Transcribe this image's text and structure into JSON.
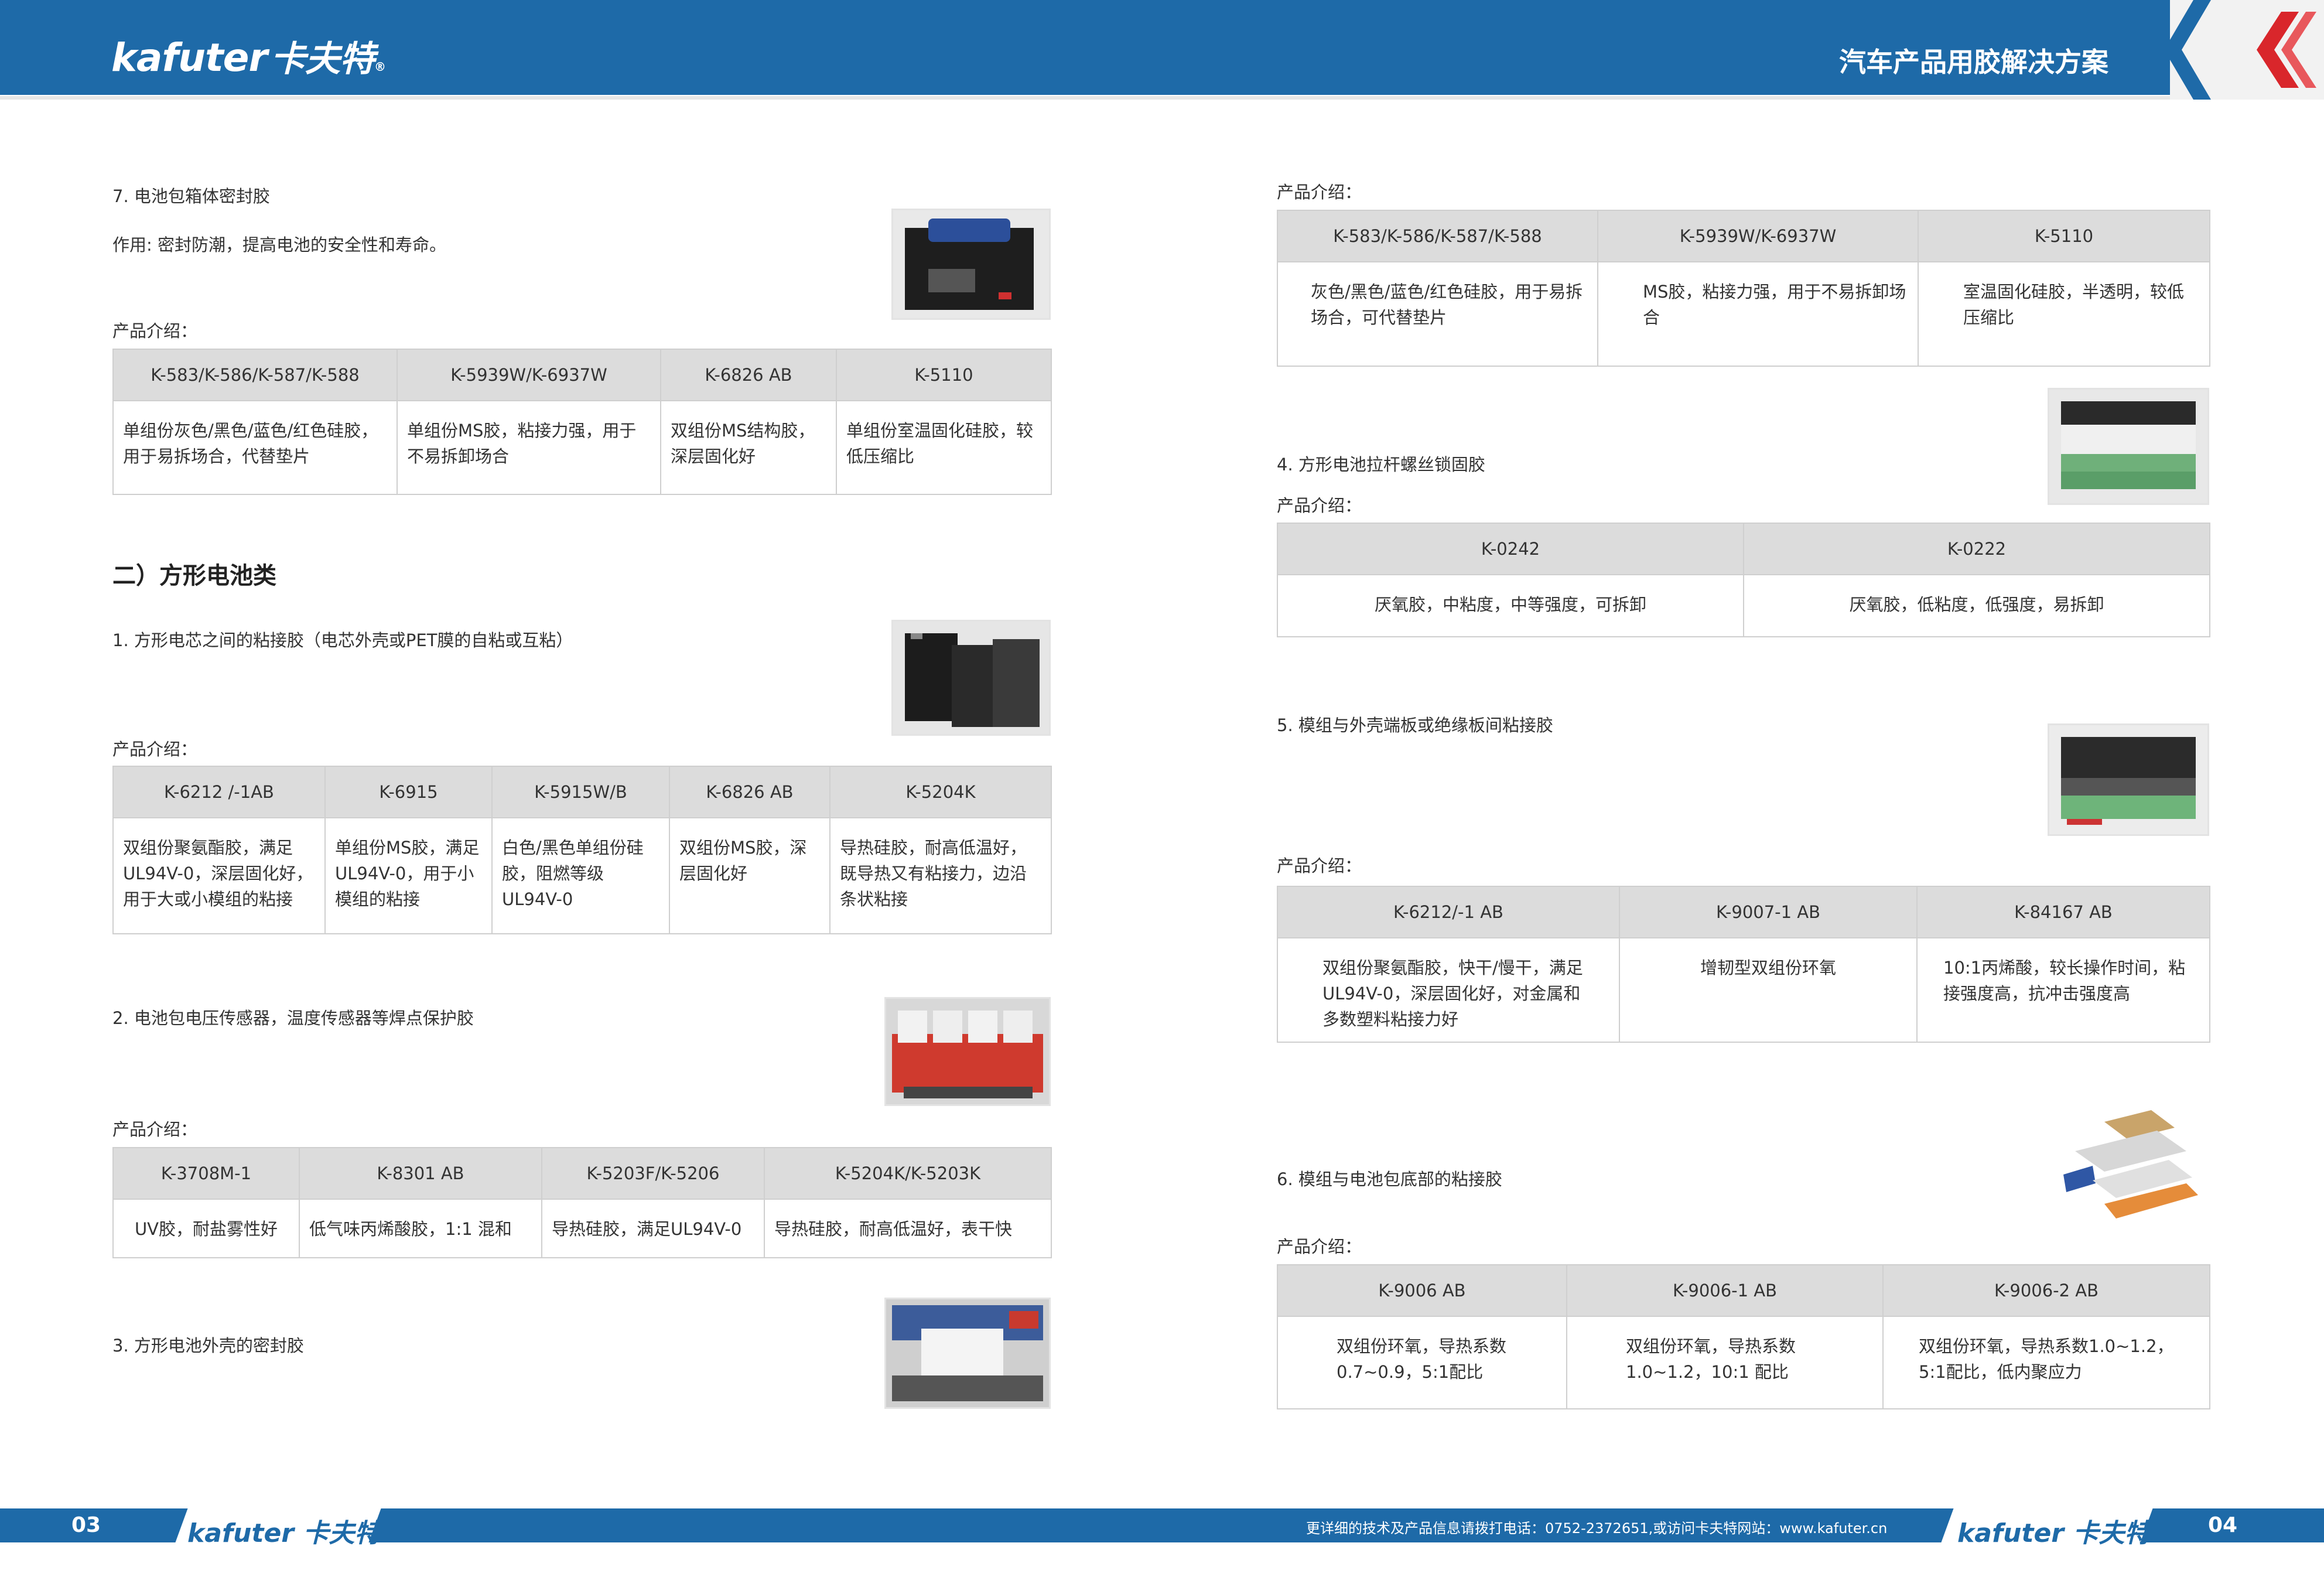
{
  "header": {
    "logo": "kafuter",
    "logo_cn": "卡夫特",
    "logo_mark": "®",
    "title": "汽车产品用胶解决方案"
  },
  "left": {
    "s7": {
      "heading": "7. 电池包箱体密封胶",
      "desc": "作用: 密封防潮，提高电池的安全性和寿命。",
      "intro": "产品介绍：",
      "headers": [
        "K-583/K-586/K-587/K-588",
        "K-5939W/K-6937W",
        "K-6826 AB",
        "K-5110"
      ],
      "cells": [
        "单组份灰色/黑色/蓝色/红色硅胶，用于易拆场合，代替垫片",
        "单组份MS胶，粘接力强，用于不易拆卸场合",
        "双组份MS结构胶，深层固化好",
        "单组份室温固化硅胶，较低压缩比"
      ]
    },
    "section_title": "二）方形电池类",
    "s1": {
      "heading": "1. 方形电芯之间的粘接胶（电芯外壳或PET膜的自粘或互粘）",
      "intro": "产品介绍：",
      "headers": [
        "K-6212 /-1AB",
        "K-6915",
        "K-5915W/B",
        "K-6826 AB",
        "K-5204K"
      ],
      "cells": [
        "双组份聚氨酯胶，满足UL94V-0，深层固化好，用于大或小模组的粘接",
        "单组份MS胶，满足UL94V-0，用于小模组的粘接",
        "白色/黑色单组份硅胶，阻燃等级UL94V-0",
        "双组份MS胶，深层固化好",
        "导热硅胶，耐高低温好，既导热又有粘接力，边沿条状粘接"
      ]
    },
    "s2": {
      "heading": "2. 电池包电压传感器，温度传感器等焊点保护胶",
      "intro": "产品介绍：",
      "headers": [
        "K-3708M-1",
        "K-8301 AB",
        "K-5203F/K-5206",
        "K-5204K/K-5203K"
      ],
      "cells": [
        "UV胶，耐盐雾性好",
        "低气味丙烯酸胶，1:1 混和",
        "导热硅胶，满足UL94V-0",
        "导热硅胶，耐高低温好，表干快"
      ]
    },
    "s3": {
      "heading": "3. 方形电池外壳的密封胶"
    }
  },
  "right": {
    "top": {
      "intro": "产品介绍：",
      "headers": [
        "K-583/K-586/K-587/K-588",
        "K-5939W/K-6937W",
        "K-5110"
      ],
      "cells": [
        "灰色/黑色/蓝色/红色硅胶，用于易拆场合，可代替垫片",
        "MS胶，粘接力强，用于不易拆卸场合",
        "室温固化硅胶，半透明，较低压缩比"
      ]
    },
    "s4": {
      "heading": "4. 方形电池拉杆螺丝锁固胶",
      "intro": "产品介绍：",
      "headers": [
        "K-0242",
        "K-0222"
      ],
      "cells": [
        "厌氧胶，中粘度，中等强度，可拆卸",
        "厌氧胶，低粘度，低强度，易拆卸"
      ]
    },
    "s5": {
      "heading": "5. 模组与外壳端板或绝缘板间粘接胶",
      "intro": "产品介绍：",
      "headers": [
        "K-6212/-1 AB",
        "K-9007-1 AB",
        "K-84167 AB"
      ],
      "cells": [
        "双组份聚氨酯胶，快干/慢干，满足UL94V-0，深层固化好，对金属和多数塑料粘接力好",
        "增韧型双组份环氧",
        "10:1丙烯酸，较长操作时间，粘接强度高，抗冲击强度高"
      ]
    },
    "s6": {
      "heading": "6. 模组与电池包底部的粘接胶",
      "intro": "产品介绍：",
      "headers": [
        "K-9006 AB",
        "K-9006-1 AB",
        "K-9006-2 AB"
      ],
      "cells": [
        "双组份环氧，导热系数0.7~0.9，5:1配比",
        "双组份环氧，导热系数1.0~1.2，10:1 配比",
        "双组份环氧，导热系数1.0~1.2，5:1配比，低内聚应力"
      ]
    }
  },
  "footer": {
    "left_page": "03",
    "right_page": "04",
    "logo": "kafuter",
    "logo_cn": "卡夫特",
    "contact": "更详细的技术及产品信息请拨打电话：0752-2372651,或访问卡夫特网站：www.kafuter.cn"
  },
  "colors": {
    "brand_blue": "#1e6aa8",
    "accent_red": "#d9262b",
    "table_header_bg": "#dcdcdc"
  }
}
